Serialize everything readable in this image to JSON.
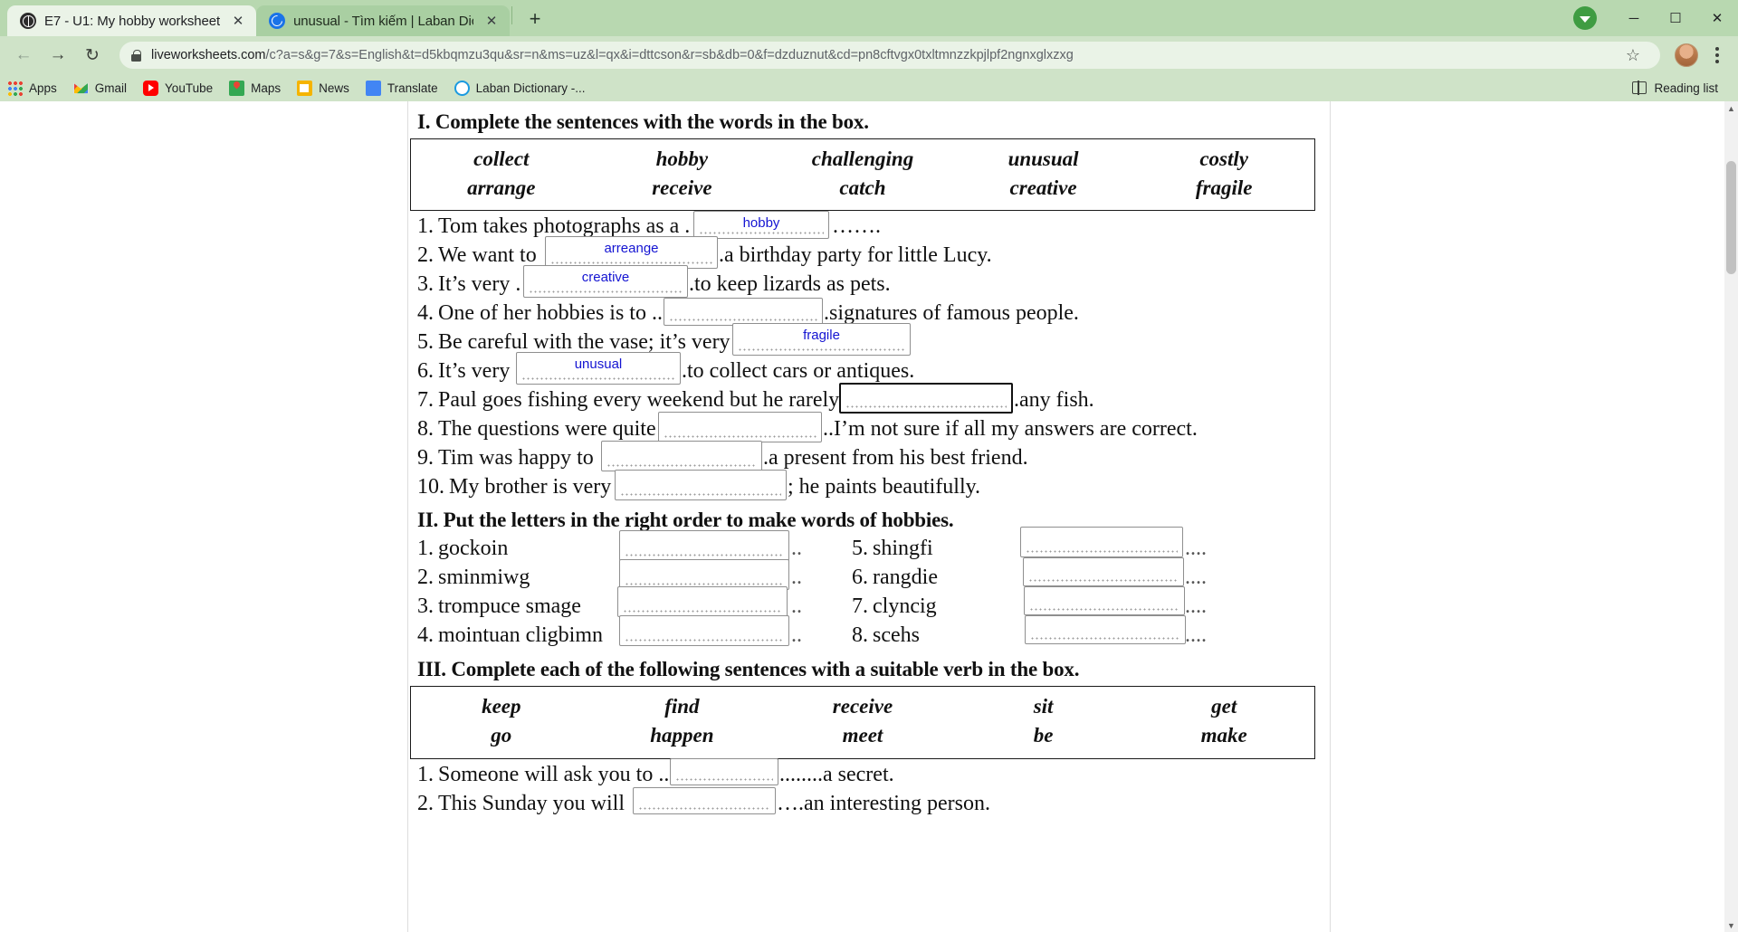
{
  "browser": {
    "tabs": [
      {
        "title": "E7 - U1: My hobby worksheet",
        "favicon": "globe-icon",
        "active": true,
        "close_label": "✕"
      },
      {
        "title": "unusual - Tìm kiếm | Laban Dictio",
        "favicon": "compass-icon",
        "active": false,
        "close_label": "✕"
      }
    ],
    "new_tab_label": "+",
    "window_controls": {
      "minimize": "─",
      "maximize": "☐",
      "close": "✕"
    },
    "nav": {
      "back": "←",
      "forward": "→",
      "reload": "↻"
    },
    "omnibox": {
      "lock": "lock-icon",
      "host": "liveworksheets.com",
      "path": "/c?a=s&g=7&s=English&t=d5kbqmzu3qu&sr=n&ms=uz&l=qx&i=dttcson&r=sb&db=0&f=dzduznut&cd=pn8cftvgx0txltmnzzkpjlpf2ngnxglxzxg",
      "star": "☆"
    },
    "bookmarks": [
      {
        "label": "Apps",
        "icon": "apps-grid-icon"
      },
      {
        "label": "Gmail",
        "icon": "gmail-icon"
      },
      {
        "label": "YouTube",
        "icon": "youtube-icon"
      },
      {
        "label": "Maps",
        "icon": "maps-icon"
      },
      {
        "label": "News",
        "icon": "news-icon"
      },
      {
        "label": "Translate",
        "icon": "translate-icon"
      },
      {
        "label": "Laban Dictionary -...",
        "icon": "laban-icon"
      }
    ],
    "reading_list": {
      "label": "Reading list",
      "icon": "reading-list-icon"
    },
    "colors": {
      "chrome_green": "#cfe3c8",
      "tabstrip_green": "#b8d8b0",
      "active_tab": "#eaf3e7",
      "answer_blue": "#1414d2"
    }
  },
  "worksheet": {
    "section1": {
      "heading": "I. Complete the sentences with the words in the box.",
      "wordbox_row1": [
        "collect",
        "hobby",
        "challenging",
        "unusual",
        "costly"
      ],
      "wordbox_row2": [
        "arrange",
        "receive",
        "catch",
        "creative",
        "fragile"
      ],
      "questions": [
        {
          "num": "1.",
          "before": "Tom takes photographs as a .",
          "answer": "hobby",
          "after": "……."
        },
        {
          "num": "2.",
          "before": "We want to",
          "answer": "arreange",
          "after": ".a birthday party for little Lucy."
        },
        {
          "num": "3.",
          "before": "It’s very .",
          "answer": "creative",
          "after": ".to keep lizards as pets."
        },
        {
          "num": "4.",
          "before": "One of her hobbies is to ..",
          "answer": "",
          "after": ".signatures of famous people."
        },
        {
          "num": "5.",
          "before": "Be careful with the vase; it’s very",
          "answer": "fragile",
          "after": ""
        },
        {
          "num": "6.",
          "before": "It’s very",
          "answer": "unusual",
          "after": ".to collect cars or antiques."
        },
        {
          "num": "7.",
          "before": "Paul goes fishing every weekend but he rarely",
          "answer": "",
          "after": ".any fish.",
          "focused": true
        },
        {
          "num": "8.",
          "before": "The questions were quite",
          "answer": "",
          "after": "..I’m not sure if all my answers are correct."
        },
        {
          "num": "9.",
          "before": "Tim was happy to",
          "answer": "",
          "after": ".a present from his best friend."
        },
        {
          "num": "10.",
          "before": "My brother is very",
          "answer": "",
          "after": "; he paints beautifully."
        }
      ]
    },
    "section2": {
      "heading": "II. Put the letters in the right order to make words of hobbies.",
      "left": [
        {
          "num": "1.",
          "word": "gockoin",
          "answer": "",
          "tail": ".."
        },
        {
          "num": "2.",
          "word": "sminmiwg",
          "answer": "",
          "tail": ".."
        },
        {
          "num": "3.",
          "word": "trompuce smage",
          "answer": "",
          "tail": ".."
        },
        {
          "num": "4.",
          "word": "mointuan cligbimn",
          "answer": "",
          "tail": ".."
        }
      ],
      "right": [
        {
          "num": "5.",
          "word": "shingfi",
          "answer": "",
          "tail": "...."
        },
        {
          "num": "6.",
          "word": "rangdie",
          "answer": "",
          "tail": "...."
        },
        {
          "num": "7.",
          "word": "clyncig",
          "answer": "",
          "tail": "...."
        },
        {
          "num": "8.",
          "word": "scehs",
          "answer": "",
          "tail": "...."
        }
      ]
    },
    "section3": {
      "heading": "III. Complete each of the following sentences with a suitable verb in the box.",
      "wordbox_row1": [
        "keep",
        "find",
        "receive",
        "sit",
        "get"
      ],
      "wordbox_row2": [
        "go",
        "happen",
        "meet",
        "be",
        "make"
      ],
      "questions": [
        {
          "num": "1.",
          "before": "Someone will ask you to ..",
          "answer": "",
          "after": "........a secret."
        },
        {
          "num": "2.",
          "before": "This Sunday you will",
          "answer": "",
          "after": "….an interesting person."
        }
      ]
    }
  }
}
